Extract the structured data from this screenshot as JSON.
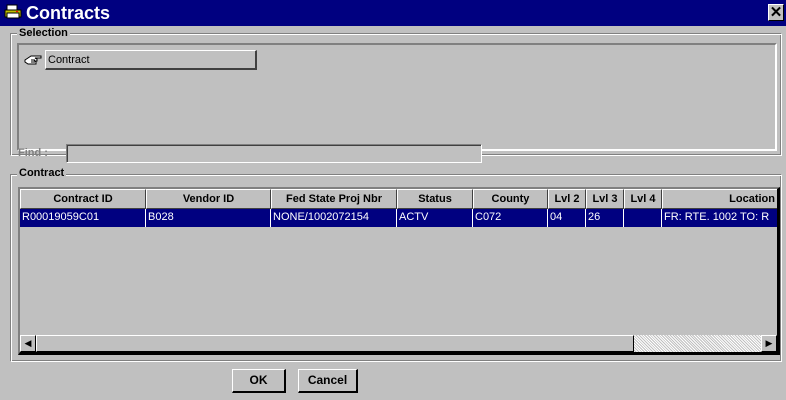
{
  "window": {
    "title": "Contracts",
    "icon": "app-printer-icon",
    "close_icon": "close-icon",
    "close_glyph": "✕"
  },
  "selection": {
    "label": "Selection",
    "item_label": "Contract",
    "item_icon": "hand-pointer-icon"
  },
  "find": {
    "label": "Find :",
    "value": ""
  },
  "contract": {
    "label": "Contract",
    "columns": [
      "Contract ID",
      "Vendor ID",
      "Fed State Proj Nbr",
      "Status",
      "County",
      "Lvl 2",
      "Lvl 3",
      "Lvl 4",
      "Location"
    ],
    "rows": [
      {
        "contract_id": "R00019059C01",
        "vendor_id": "B028",
        "fed_state_proj_nbr": "NONE/1002072154",
        "status": "ACTV",
        "county": "C072",
        "lvl2": "04",
        "lvl3": "26",
        "lvl4": "",
        "location": "FR: RTE. 1002  TO: R"
      }
    ]
  },
  "scrollbar": {
    "left_arrow": "◀",
    "right_arrow": "▶"
  },
  "buttons": {
    "ok": "OK",
    "cancel": "Cancel"
  },
  "colors": {
    "title_bar": "#000080",
    "selected_row": "#000080",
    "window_bg": "#c0c0c0"
  }
}
